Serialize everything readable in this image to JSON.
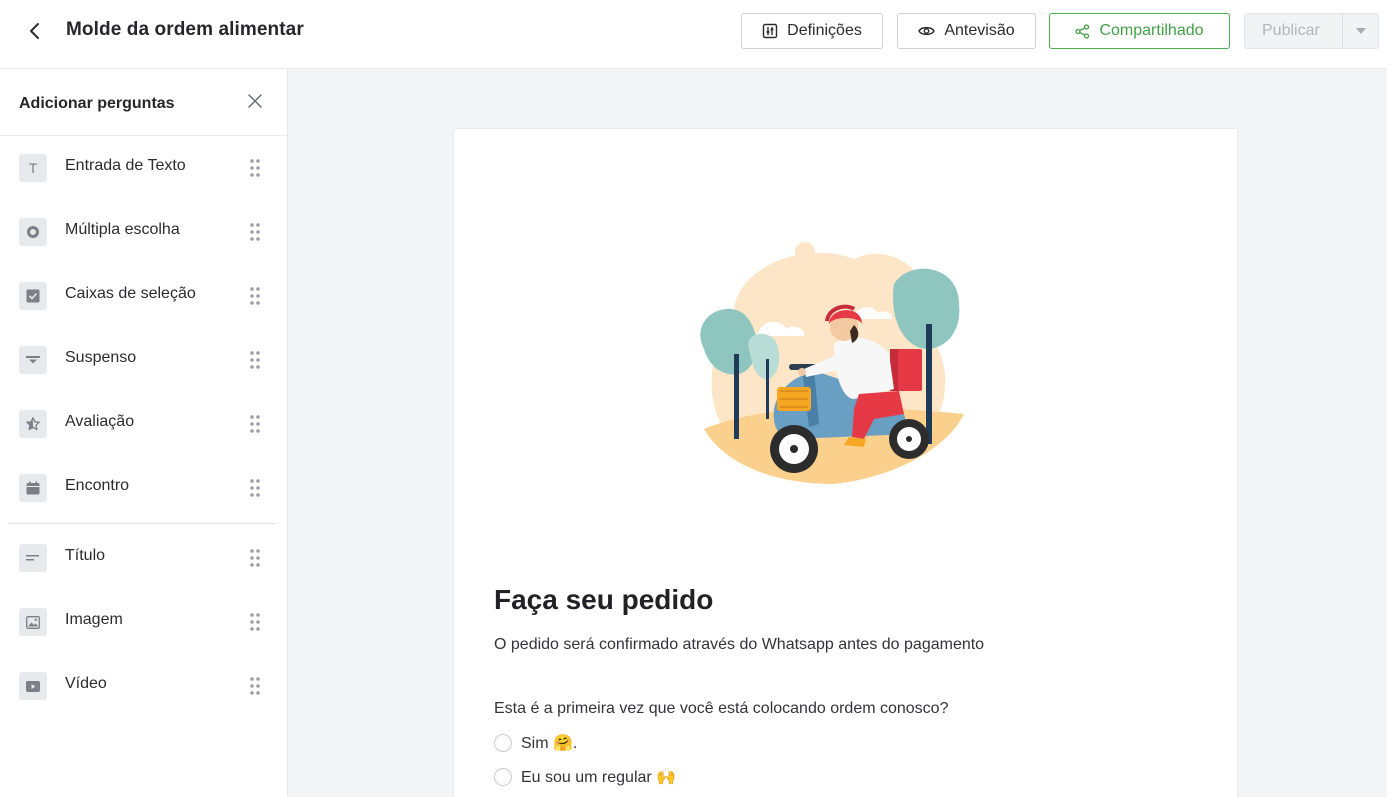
{
  "header": {
    "title": "Molde da ordem alimentar",
    "settings_label": "Definições",
    "preview_label": "Antevisão",
    "share_label": "Compartilhado",
    "publish_label": "Publicar"
  },
  "sidebar": {
    "title": "Adicionar perguntas",
    "items": [
      {
        "label": "Entrada de Texto",
        "icon": "text-icon"
      },
      {
        "label": "Múltipla escolha",
        "icon": "radio-icon"
      },
      {
        "label": "Caixas de seleção",
        "icon": "checkbox-icon"
      },
      {
        "label": "Suspenso",
        "icon": "dropdown-icon"
      },
      {
        "label": "Avaliação",
        "icon": "star-icon"
      },
      {
        "label": "Encontro",
        "icon": "calendar-icon"
      },
      {
        "label": "Título",
        "icon": "heading-icon"
      },
      {
        "label": "Imagem",
        "icon": "image-icon"
      },
      {
        "label": "Vídeo",
        "icon": "video-icon"
      }
    ],
    "text_icon_glyph": "T"
  },
  "form": {
    "title": "Faça seu pedido",
    "description": "O pedido será confirmado através do Whatsapp antes do pagamento",
    "question": "Esta é a primeira vez que você está colocando ordem conosco?",
    "options": [
      "Sim 🤗.",
      "Eu sou um regular 🙌"
    ]
  },
  "colors": {
    "accent_green": "#43a047",
    "background": "#f3f4f6"
  }
}
